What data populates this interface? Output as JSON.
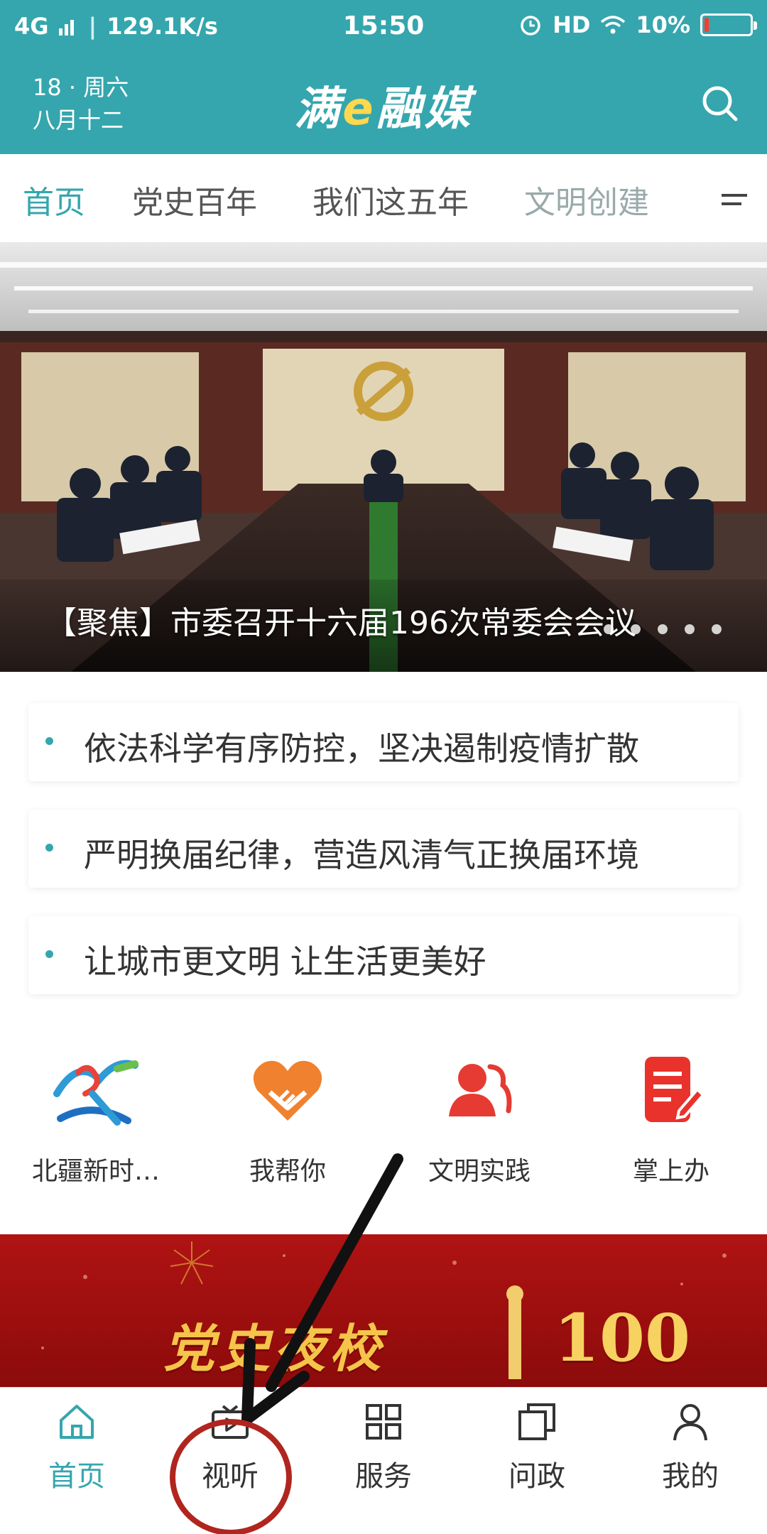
{
  "status_bar": {
    "network": "4G",
    "speed": "129.1K/s",
    "time": "15:50",
    "hd": "HD",
    "battery": "10%",
    "battery_level": 0.1,
    "icons": [
      "signal-icon",
      "alarm-icon",
      "wifi-icon",
      "battery-icon"
    ]
  },
  "header": {
    "date_line1": "18 · 周六",
    "date_line2": "八月十二",
    "logo_main1": "满",
    "logo_accent": "e",
    "logo_main2": "融媒",
    "search_icon": "search-icon"
  },
  "nav_tabs": [
    "首页",
    "党史百年",
    "我们这五年",
    "文明创建"
  ],
  "banner": {
    "title": "【聚焦】市委召开十六届196次常委会会议"
  },
  "headlines": [
    "依法科学有序防控，坚决遏制疫情扩散",
    "严明换届纪律，营造风清气正换届环境",
    "让城市更文明  让生活更美好"
  ],
  "quick_actions": [
    {
      "label": "北疆新时…",
      "icon": "beijiang-logo-icon"
    },
    {
      "label": "我帮你",
      "icon": "heart-handshake-icon"
    },
    {
      "label": "文明实践",
      "icon": "people-icon"
    },
    {
      "label": "掌上办",
      "icon": "document-edit-icon"
    }
  ],
  "promo": {
    "title": "党史夜校",
    "number": "100"
  },
  "bottom_nav": [
    {
      "label": "首页",
      "icon": "home-icon",
      "active": true
    },
    {
      "label": "视听",
      "icon": "video-icon",
      "active": false
    },
    {
      "label": "服务",
      "icon": "grid-icon",
      "active": false
    },
    {
      "label": "问政",
      "icon": "pages-icon",
      "active": false
    },
    {
      "label": "我的",
      "icon": "user-icon",
      "active": false
    }
  ],
  "colors": {
    "primary": "#35a6ad",
    "promo_red": "#b01313",
    "annotation": "#b1251f"
  }
}
